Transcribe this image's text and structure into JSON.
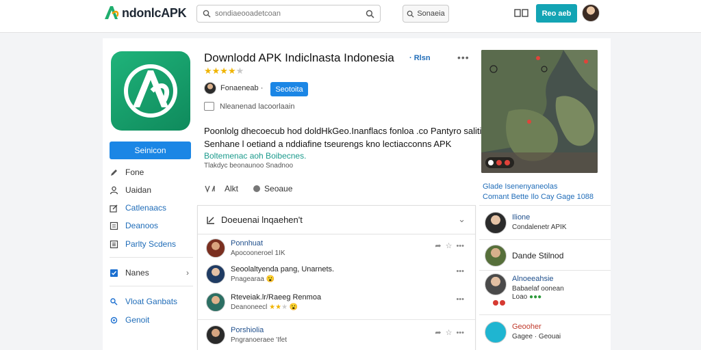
{
  "header": {
    "logo_text": "ndonlcAPK",
    "search_placeholder": "sondiaeooadetcoan",
    "search_button": "Sonaeia",
    "primary_button": "Reo aeb"
  },
  "app": {
    "title": "Downlodd APK Indiclnasta Indonesia",
    "title_tag": "· Rlsn",
    "rating": 4,
    "rating_max": 5,
    "install_label": "Seinicon",
    "developer": "Fonaeneab ·",
    "follow_label": "Seotoita",
    "meta": "Nleanenad lacoorlaain",
    "desc_line1": "Poonlolg dhecoecub hod doldHkGeo.Inanflacs fonloa .co Pantyro salitik",
    "desc_line2": "Senhane l oetiand a nddiafine tseurengs kno lectiacconns APK",
    "desc_line3": "Boltemenac aoh Boibecnes.",
    "desc_line4": "Tlakdyc beonaunoo Snadnoo",
    "action_like": "Alkt",
    "action_share": "Seoaue"
  },
  "nav": {
    "items": [
      {
        "label": "Fone"
      },
      {
        "label": "Uaidan"
      },
      {
        "label": "Catlenaacs"
      },
      {
        "label": "Deanoos"
      },
      {
        "label": "Parlty Scdens"
      },
      {
        "label": "Nanes"
      },
      {
        "label": "Vloat Ganbats"
      },
      {
        "label": "Genoit"
      }
    ]
  },
  "comments": {
    "heading": "Doeuenai lnqaehen't",
    "items": [
      {
        "name": "Ponnhuat",
        "sub": "Apocooneroel 1IK"
      },
      {
        "name": "Seoolaltyenda pang, Unarnets.",
        "sub": "Pnagearaa"
      },
      {
        "name": "Rteveiak.lr/Raeeg Renmoa",
        "sub": "Deanoneecl"
      },
      {
        "name": "Porshiolia",
        "sub": "Pngranoeraee 'Ifet"
      }
    ]
  },
  "sidebar": {
    "link1": "Glade Isenenyaneolas",
    "link2": "Comant Bette Ilo Cay Gage 1088",
    "items": [
      {
        "name": "Ilione",
        "sub": "Condalenetr APIK"
      },
      {
        "name": "Dande Stilnod",
        "sub": ""
      },
      {
        "name": "Alnoeeahsie",
        "sub": "Babaelaf oonean",
        "sub2": "Loao"
      },
      {
        "name": "Geooher",
        "sub": "Gagee · Geouai"
      }
    ]
  }
}
